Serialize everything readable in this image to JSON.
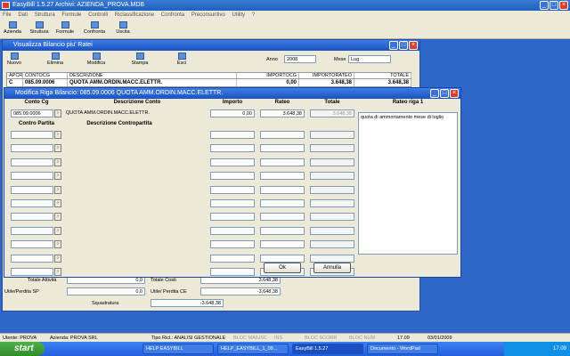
{
  "app": {
    "title": "EasyBill   1.5.27          Archivi: AZIENDA_PROVA.MDB",
    "menu": [
      "File",
      "Dati",
      "Struttura",
      "Formule",
      "Controlli",
      "Riclassificazione",
      "Confronta",
      "Preconsuntivo",
      "Utility",
      "?"
    ],
    "toolbar": [
      "Azienda",
      "Struttura",
      "Formule",
      "Confronta",
      "Uscita"
    ]
  },
  "bilancio": {
    "title": "Visualizza Bilancio piu' Ratei",
    "tools": [
      "Nuovo",
      "Elimina",
      "Modifica",
      "Stampa",
      "Esci"
    ],
    "anno_label": "Anno",
    "anno_value": "2008",
    "mese_label": "Mese",
    "mese_value": "Lug",
    "grid_headers": [
      "APCR",
      "CONTOCG",
      "DESCRIZIONE",
      "IMPORTOCG",
      "IMPORTORATEO",
      "TOTALE"
    ],
    "grid_row": [
      "C",
      "085.09.0006",
      "QUOTA AMM.ORDIN.MACC.ELETTR.",
      "0,00",
      "3.648,38",
      "3.648,38"
    ],
    "totale_attivita_label": "Totale Attività",
    "totale_attivita_value": "0,0",
    "totale_costi_label": "Totale Costi",
    "totale_costi_value": "3.648,38",
    "utile_sp_label": "Utile/Perdita SP",
    "utile_sp_value": "0,0",
    "utile_ce_label": "Utile/ Perdita CE",
    "utile_ce_value": "-3.648,38",
    "squadratura_label": "Squadratura",
    "squadratura_value": "-3.648,38"
  },
  "dialog": {
    "title": "Modifica Riga Bilancio: 085.09.0006 QUOTA AMM.ORDIN.MACC.ELETTR.",
    "headers": {
      "conto_cg": "Conto Cg",
      "descrizione_conto": "Descrizione Conto",
      "importo": "Importo",
      "rateo": "Rateo",
      "totale": "Totale",
      "rateo_riga": "Rateo riga 1",
      "contro_partita": "Contro Partita",
      "descrizione_contropartita": "Descrizione Contropartita"
    },
    "conto_cg_value": "085.09.0006",
    "descrizione_value": "QUOTA AMM.ORDIN.MACC.ELETTR.",
    "importo_value": "0,00",
    "rateo_value": "3.648,38",
    "totale_value": "3.648,38",
    "note": "quota di ammortamento mese di luglio",
    "ok_label": "Ok",
    "annulla_label": "Annulla"
  },
  "status": {
    "utente": "Utente: PROVA",
    "azienda": "Azienda: PROVA SRL",
    "tipo": "Tipo Ricl.: ANALISI GESTIONALE",
    "bloc_maiusc": "BLOC MAIUSC",
    "ins": "INS",
    "bloc_scorr": "BLOC SCORR",
    "bloc_num": "BLOC NUM",
    "time": "17.09",
    "date": "03/01/2009"
  },
  "taskbar": {
    "start": "start",
    "tasks": [
      "HELP EASYBILL",
      "HELP_EASYBILL_1_09...",
      "EasyBill  1.5.27",
      "Documento - WordPad"
    ],
    "clock": "17.09"
  }
}
